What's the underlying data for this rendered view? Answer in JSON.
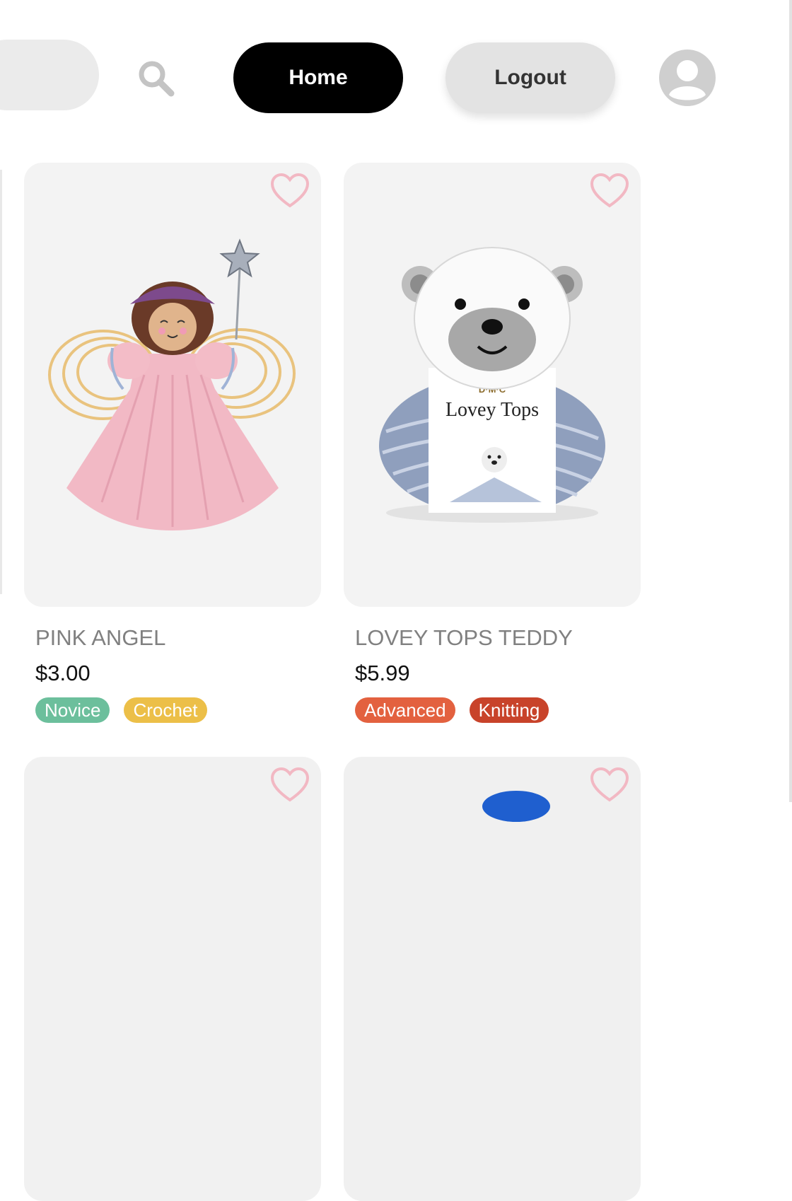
{
  "header": {
    "home_label": "Home",
    "logout_label": "Logout",
    "icons": {
      "search": "search-icon",
      "avatar": "user-avatar-icon"
    }
  },
  "products": [
    {
      "title": "PINK ANGEL",
      "price": "$3.00",
      "tags": [
        {
          "label": "Novice",
          "color": "#6cbf9c"
        },
        {
          "label": "Crochet",
          "color": "#ecbf48"
        }
      ],
      "favorite_icon": "heart-outline-icon",
      "image_subject": "angel-doll-image"
    },
    {
      "title": "LOVEY TOPS TEDDY",
      "price": "$5.99",
      "tags": [
        {
          "label": "Advanced",
          "color": "#e3613f"
        },
        {
          "label": "Knitting",
          "color": "#c8432a"
        }
      ],
      "favorite_icon": "heart-outline-icon",
      "image_subject": "teddy-yarn-image",
      "image_text": {
        "brand": "D·M·C",
        "product": "Lovey Tops"
      }
    },
    {
      "favorite_icon": "heart-outline-icon"
    },
    {
      "favorite_icon": "heart-outline-icon"
    }
  ],
  "colors": {
    "heart": "#f2b8c3",
    "home_bg": "#000000",
    "logout_bg": "#e3e3e3"
  }
}
